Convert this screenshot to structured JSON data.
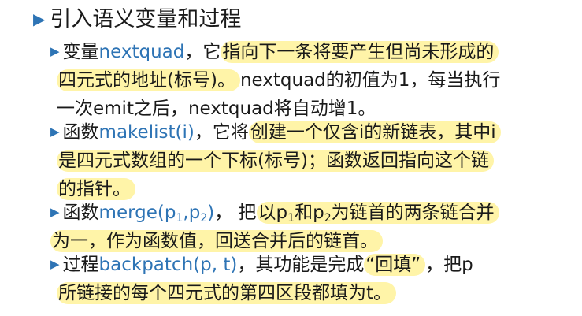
{
  "heading": "引入语义变量和过程",
  "item1": {
    "l1_pre": "变量",
    "l1_kw": "nextquad",
    "l1_mid": "，它",
    "l1_hl": "指向下一条将要产生但尚未形成的",
    "l2_hl": "四元式的地址(标号)。",
    "l2_rest": "nextquad的初值为1，每当执行",
    "l3": "一次emit之后，nextquad将自动增1。"
  },
  "item2": {
    "l1_pre": "函数",
    "l1_kw": "makelist(i)",
    "l1_mid": "，它将",
    "l1_hl": "创建一个仅含i的新链表，其中i",
    "l2_hl": "是四元式数组的一个下标(标号)；函数返回指向这个链",
    "l3_hl": "的指针。"
  },
  "item3": {
    "l1_pre": "函数",
    "l1_kw_a": "merge(p",
    "l1_kw_s1": "1",
    "l1_kw_b": ",p",
    "l1_kw_s2": "2",
    "l1_kw_c": ")",
    "l1_mid": "， 把",
    "l1_hl_a": "以p",
    "l1_hl_s1": "1",
    "l1_hl_b": "和p",
    "l1_hl_s2": "2",
    "l1_hl_c": "为链首的两条链合并",
    "l2_hl": "为一，作为函数值，回送合并后的链首。"
  },
  "item4": {
    "l1_pre": "过程",
    "l1_kw": "backpatch(p, t)",
    "l1_mid": "，其功能是完成",
    "l1_hl": "“回填”",
    "l1_rest": "，把p",
    "l2_hl": "所链接的每个四元式的第四区段都填为t。"
  },
  "icons": {
    "bullet": "triangle-right-icon"
  },
  "colors": {
    "accent": "#2e74b5",
    "highlight": "#fff4a8",
    "text": "#1a1a1a"
  }
}
